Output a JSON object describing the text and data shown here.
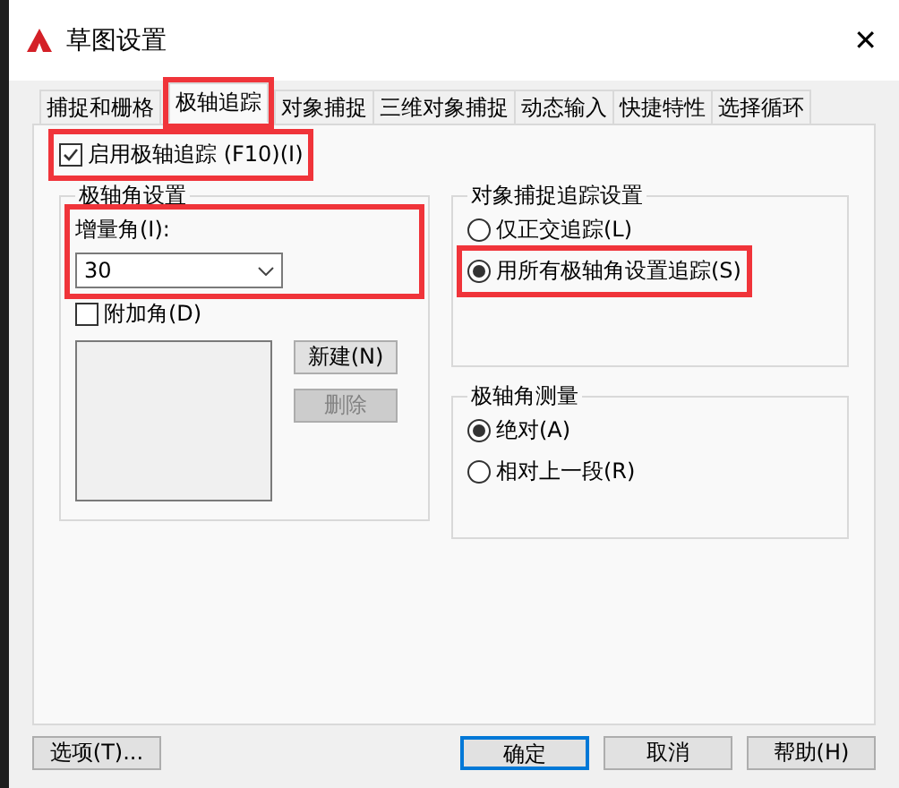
{
  "window": {
    "title": "草图设置",
    "close": "✕"
  },
  "tabs": [
    {
      "label": "捕捉和栅格",
      "selected": false,
      "highlighted": false
    },
    {
      "label": "极轴追踪",
      "selected": true,
      "highlighted": true
    },
    {
      "label": "对象捕捉",
      "selected": false,
      "highlighted": false
    },
    {
      "label": "三维对象捕捉",
      "selected": false,
      "highlighted": false
    },
    {
      "label": "动态输入",
      "selected": false,
      "highlighted": false
    },
    {
      "label": "快捷特性",
      "selected": false,
      "highlighted": false
    },
    {
      "label": "选择循环",
      "selected": false,
      "highlighted": false
    }
  ],
  "enable_tracking": {
    "label": "启用极轴追踪 (F10)(I)",
    "checked": true,
    "highlighted": true
  },
  "polar_angle_settings": {
    "title": "极轴角设置",
    "increment": {
      "label": "增量角(I):",
      "value": "30",
      "highlighted": true
    },
    "additional": {
      "label": "附加角(D)",
      "checked": false
    },
    "new_button": {
      "label": "新建(N)",
      "disabled": false
    },
    "delete_button": {
      "label": "删除",
      "disabled": true
    }
  },
  "snap_tracking": {
    "title": "对象捕捉追踪设置",
    "options": [
      {
        "label": "仅正交追踪(L)",
        "selected": false,
        "highlighted": false
      },
      {
        "label": "用所有极轴角设置追踪(S)",
        "selected": true,
        "highlighted": true
      }
    ]
  },
  "measurement": {
    "title": "极轴角测量",
    "options": [
      {
        "label": "绝对(A)",
        "selected": true,
        "highlighted": false
      },
      {
        "label": "相对上一段(R)",
        "selected": false,
        "highlighted": false
      }
    ]
  },
  "buttons": [
    {
      "label": "选项(T)...",
      "default": false
    },
    {
      "label": "确定",
      "default": true
    },
    {
      "label": "取消",
      "default": false
    },
    {
      "label": "帮助(H)",
      "default": false
    }
  ]
}
